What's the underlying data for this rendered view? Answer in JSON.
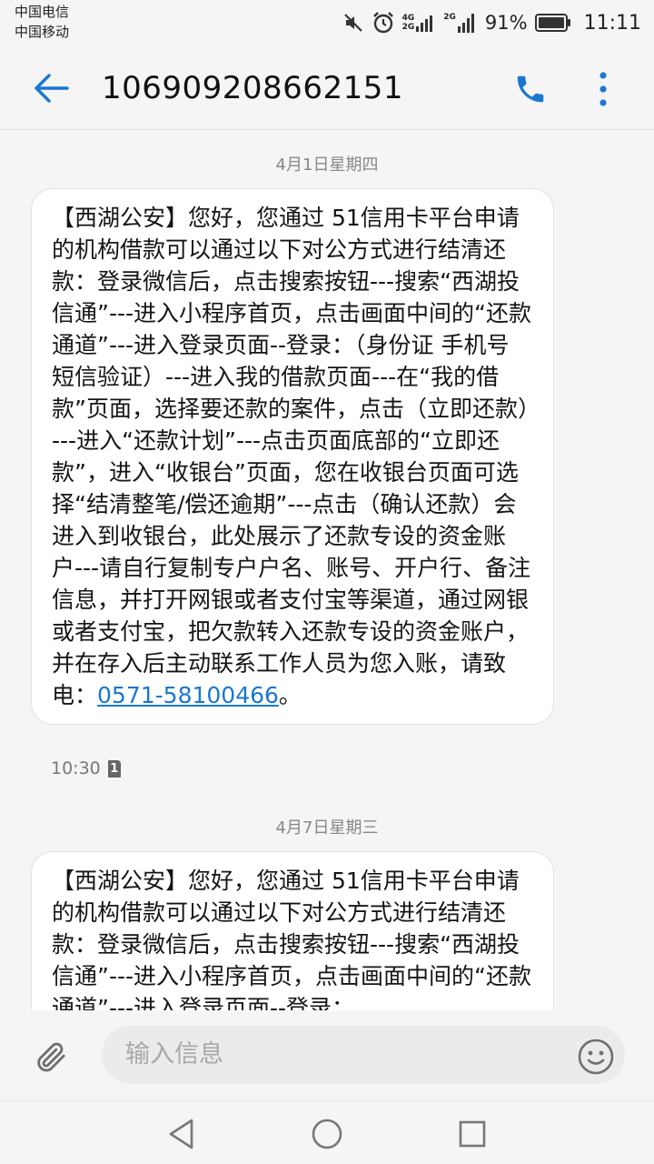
{
  "status_bar": {
    "carrier_1": "中国电信",
    "carrier_2": "中国移动",
    "net_1_top": "4G",
    "net_1_bottom": "2G",
    "net_2": "2G",
    "battery": "91%",
    "time": "11:11",
    "icons": [
      "mute-icon",
      "alarm-icon",
      "signal-icon",
      "battery-icon"
    ]
  },
  "header": {
    "contact_number": "106909208662151",
    "back_icon": "arrow-left-icon",
    "call_icon": "phone-icon",
    "more_icon": "more-vertical-icon",
    "accent_color": "#1a77d2"
  },
  "messages": [
    {
      "date": "4月1日星期四",
      "text": "【西湖公安】您好，您通过 51信用卡平台申请的机构借款可以通过以下对公方式进行结清还款：登录微信后，点击搜索按钮---搜索“西湖投信通”---进入小程序首页，点击画面中间的“还款通道”---进入登录页面--登录：（身份证 手机号 短信验证）---进入我的借款页面---在“我的借款”页面，选择要还款的案件，点击（立即还款）---进入“还款计划”---点击页面底部的“立即还款”，进入“收银台”页面，您在收银台页面可选择“结清整笔/偿还逾期”---点击（确认还款）会进入到收银台，此处展示了还款专设的资金账户---请自行复制专户户名、账号、开户行、备注信息，并打开网银或者支付宝等渠道，通过网银或者支付宝，把欠款转入还款专设的资金账户，并在存入后主动联系工作人员为您入账，请致电：",
      "phone": "0571-58100466",
      "ending": "。",
      "time": "10:30",
      "sim": "1"
    },
    {
      "date": "4月7日星期三",
      "text": "【西湖公安】您好，您通过 51信用卡平台申请的机构借款可以通过以下对公方式进行结清还款：登录微信后，点击搜索按钮---搜索“西湖投信通”---进入小程序首页，点击画面中间的“还款通道”---进入登录页面--登录："
    }
  ],
  "composer": {
    "placeholder": "输入信息",
    "attach_icon": "paperclip-icon",
    "emoji_icon": "emoji-icon"
  },
  "nav_bar": {
    "icons": [
      "nav-back-icon",
      "nav-home-icon",
      "nav-recent-icon"
    ]
  }
}
